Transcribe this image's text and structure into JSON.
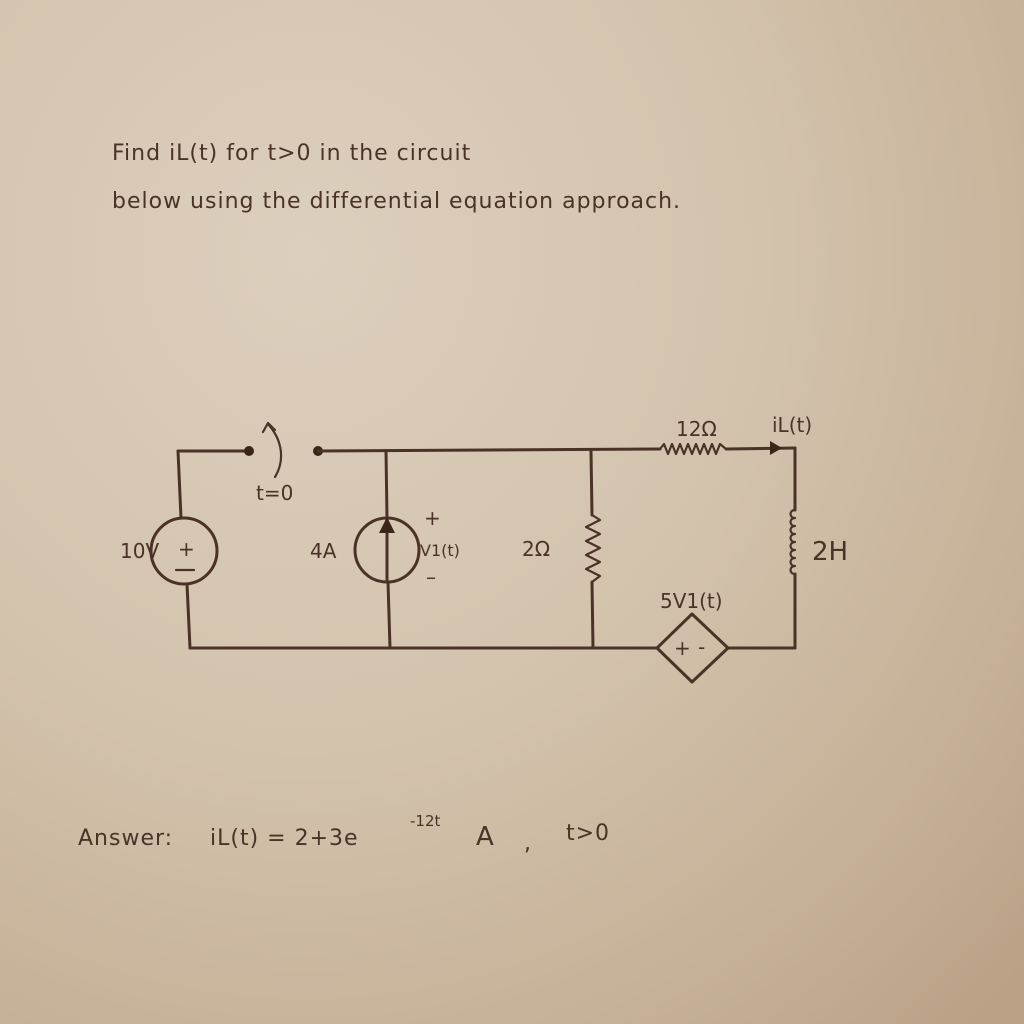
{
  "problem": {
    "line1": "Find iL(t) for t>0 in the circuit",
    "line2": "below using the differential equation approach."
  },
  "circuit": {
    "voltage_source": {
      "label": "10V",
      "plus": "+",
      "minus": "—"
    },
    "switch": {
      "label": "t=0"
    },
    "current_source": {
      "label": "4A"
    },
    "v1": {
      "label": "V1(t)",
      "plus": "+",
      "minus": "–"
    },
    "resistor_2": {
      "label": "2Ω"
    },
    "resistor_12": {
      "label": "12Ω"
    },
    "inductor_current": {
      "label": "iL(t)"
    },
    "inductor": {
      "label": "2H"
    },
    "dependent_source": {
      "label": "5V1(t)",
      "plus": "+",
      "minus": "-"
    }
  },
  "answer": {
    "prefix": "Answer:",
    "lhs": "iL(t) = 2+3e",
    "exponent": "-12t",
    "unit": "A",
    "separator": ",",
    "condition": "t>0"
  },
  "colors": {
    "ink": "#4a3326",
    "paper": "#d3c3ad"
  }
}
